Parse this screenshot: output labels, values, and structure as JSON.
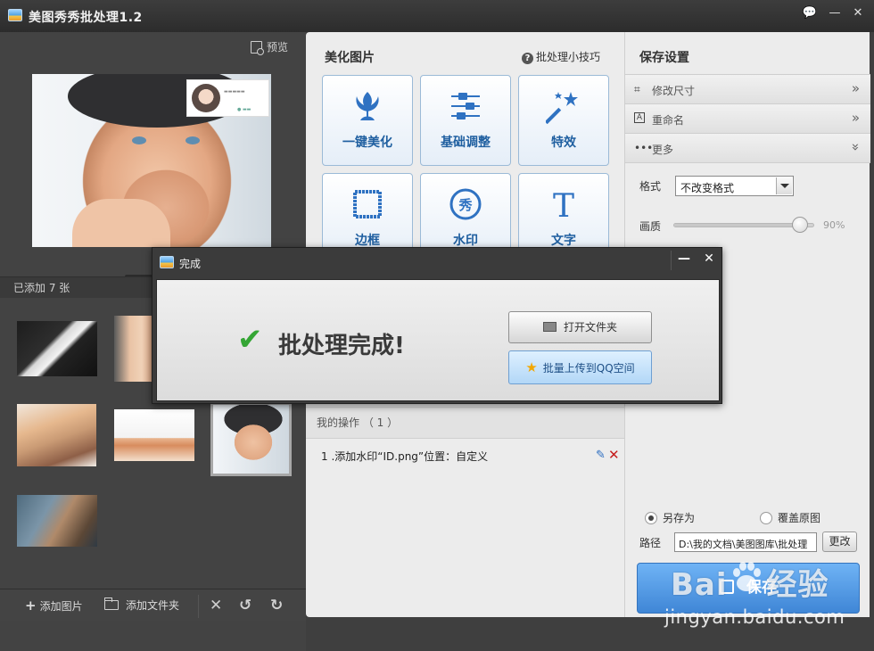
{
  "window": {
    "title": "美图秀秀批处理1.2",
    "buttons": {
      "feedback": "💬",
      "minimize": "—",
      "close": "✕"
    }
  },
  "left": {
    "preview_link": "预览",
    "added_count": "已添加 7 张",
    "toolbar": {
      "add_image": "添加图片",
      "add_folder": "添加文件夹",
      "delete": "✕",
      "rotate_left": "↺",
      "rotate_right": "↻"
    }
  },
  "middle": {
    "header": "美化图片",
    "tips": "批处理小技巧",
    "tools": [
      {
        "label": "一键美化",
        "icon": "tulip-icon"
      },
      {
        "label": "基础调整",
        "icon": "sliders-icon"
      },
      {
        "label": "特效",
        "icon": "magic-wand-icon"
      },
      {
        "label": "边框",
        "icon": "frame-icon"
      },
      {
        "label": "水印",
        "icon": "watermark-icon"
      },
      {
        "label": "文字",
        "icon": "text-icon"
      }
    ],
    "ops_header": "我的操作 （ 1 ）",
    "ops": [
      {
        "text": "1 .添加水印“ID.png”位置：自定义"
      }
    ]
  },
  "right": {
    "title": "保存设置",
    "accordions": [
      {
        "label": "修改尺寸",
        "icon": "crop-icon",
        "chevron": "»"
      },
      {
        "label": "重命名",
        "icon": "rename-icon",
        "chevron": "»"
      },
      {
        "label": "更多",
        "icon": "more-icon",
        "chevron": "»"
      }
    ],
    "format_label": "格式",
    "format_value": "不改变格式",
    "quality_label": "画质",
    "quality_value": "90%",
    "quality_fraction": 0.9,
    "save_as": "另存为",
    "overwrite": "覆盖原图",
    "path_label": "路径",
    "path_value": "D:\\我的文档\\美图图库\\批处理",
    "change_button": "更改",
    "save_button": "保存"
  },
  "dialog": {
    "title": "完成",
    "message": "批处理完成!",
    "open_folder": "打开文件夹",
    "upload_qzone": "批量上传到QQ空间",
    "minimize": "—",
    "close": "✕"
  },
  "watermark": {
    "logo_left": "Bai",
    "logo_right": "经验",
    "url": "jingyan.baidu.com"
  },
  "colors": {
    "accent": "#3f86d6",
    "tool_label": "#1f5fa0",
    "check": "#34a534",
    "delete": "#c51d1d"
  }
}
